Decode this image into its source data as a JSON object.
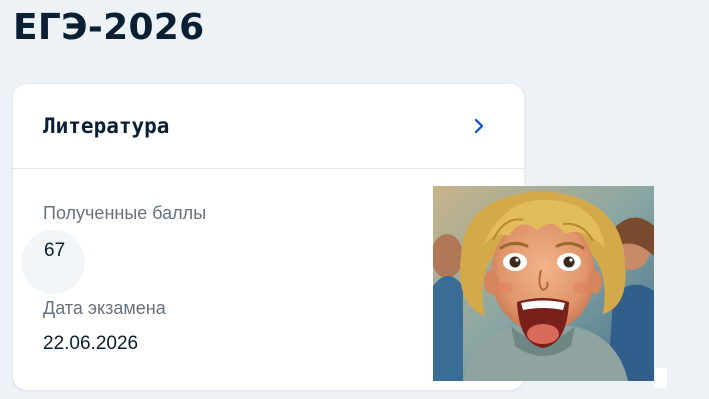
{
  "page": {
    "title": "ЕГЭ-2026"
  },
  "subject_card": {
    "subject_name": "Литература",
    "score_label": "Полученные баллы",
    "score_value": "67",
    "date_label": "Дата экзамена",
    "date_value": "22.06.2026",
    "open_icon": "chevron-right-icon",
    "image_subject": "illustration of an excited blond teen shouting"
  },
  "colors": {
    "background": "#edf2f7",
    "card": "#ffffff",
    "text_primary": "#0b1f33",
    "text_secondary": "#66727f",
    "accent": "#0d4cd3"
  }
}
